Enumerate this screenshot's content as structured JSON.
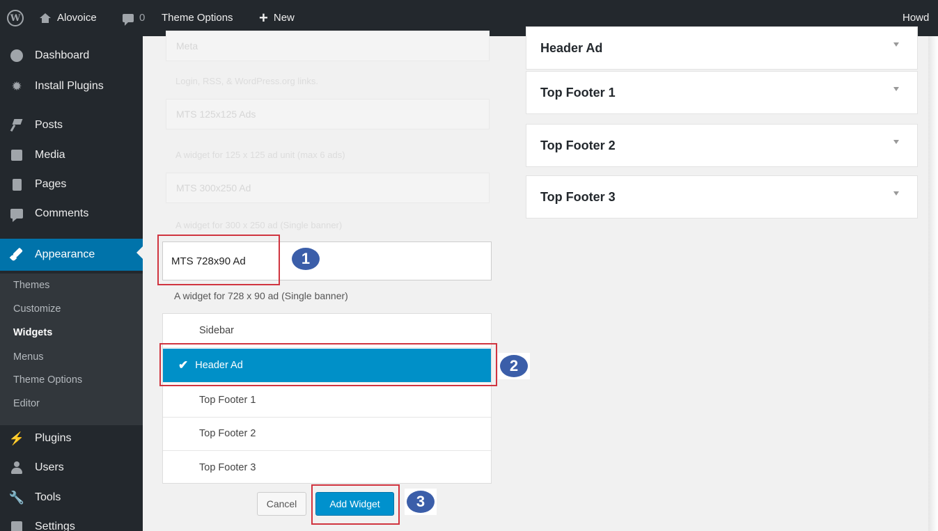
{
  "adminbar": {
    "site_name": "Alovoice",
    "comments_count": "0",
    "theme_options": "Theme Options",
    "new_label": "New",
    "howdy": "Howd"
  },
  "sidebar": {
    "dashboard": "Dashboard",
    "install_plugins": "Install Plugins",
    "posts": "Posts",
    "media": "Media",
    "pages": "Pages",
    "comments": "Comments",
    "appearance": "Appearance",
    "submenu": [
      "Themes",
      "Customize",
      "Widgets",
      "Menus",
      "Theme Options",
      "Editor"
    ],
    "plugins": "Plugins",
    "users": "Users",
    "tools": "Tools",
    "settings": "Settings"
  },
  "available_widgets": [
    {
      "title": "Meta",
      "desc": "Login, RSS, & WordPress.org links."
    },
    {
      "title": "MTS 125x125 Ads",
      "desc": "A widget for 125 x 125 ad unit (max 6 ads)"
    },
    {
      "title": "MTS 300x250 Ad",
      "desc": "A widget for 300 x 250 ad (Single banner)"
    }
  ],
  "selected_widget": {
    "title": "MTS 728x90 Ad",
    "desc": "A widget for 728 x 90 ad (Single banner)"
  },
  "widget_areas_choice": [
    "Sidebar",
    "Header Ad",
    "Top Footer 1",
    "Top Footer 2",
    "Top Footer 3"
  ],
  "selected_area": "Header Ad",
  "buttons": {
    "cancel": "Cancel",
    "add_widget": "Add Widget"
  },
  "steps": [
    "1",
    "2",
    "3"
  ],
  "widget_areas": [
    "Header Ad",
    "Top Footer 1",
    "Top Footer 2",
    "Top Footer 3"
  ],
  "colors": {
    "accent": "#0073aa",
    "selected_option": "#0090c8",
    "highlight": "#d0343f",
    "step_badge": "#3b5ea9"
  }
}
